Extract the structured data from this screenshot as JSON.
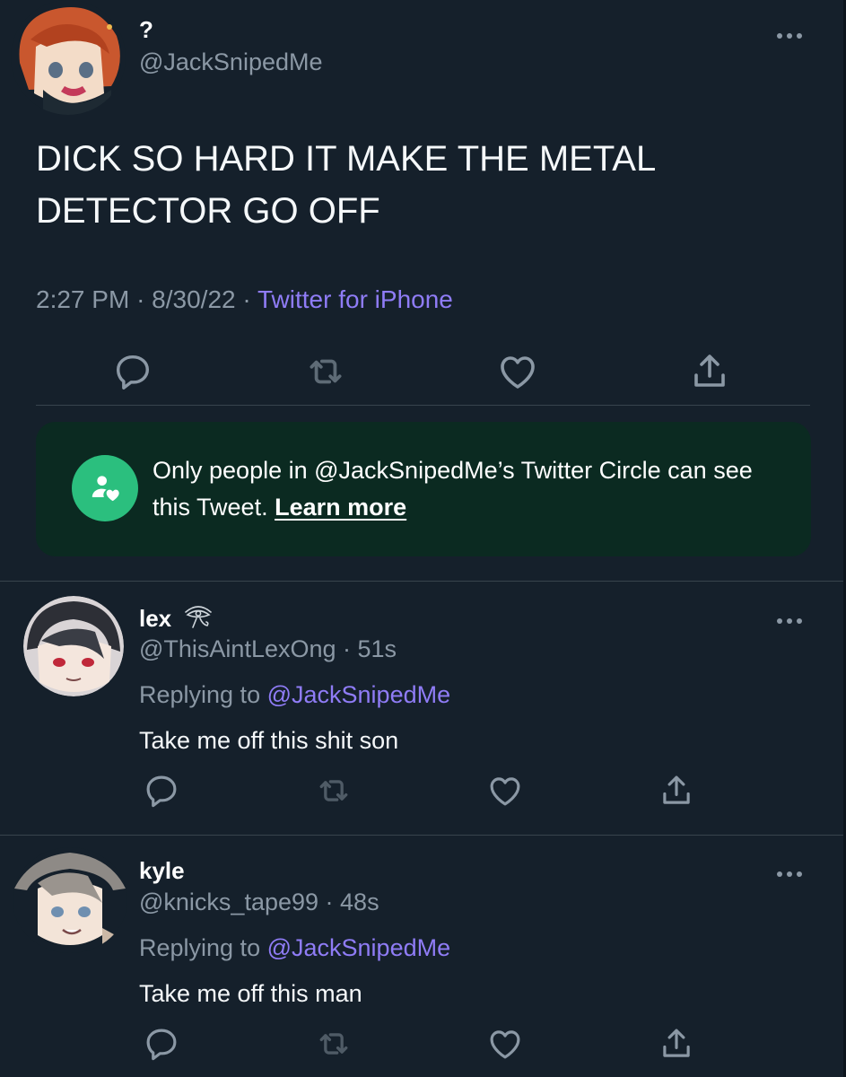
{
  "main_tweet": {
    "author_name": "?",
    "author_handle": "@JackSnipedMe",
    "text": "DICK SO HARD IT MAKE THE METAL DETECTOR GO OFF",
    "time": "2:27 PM",
    "date": "8/30/22",
    "separator": "·",
    "source": "Twitter for iPhone"
  },
  "circle_notice": {
    "text": "Only people in @JackSnipedMe’s Twitter Circle can see this Tweet.",
    "link": "Learn more"
  },
  "replies": [
    {
      "name": "lex",
      "handle": "@ThisAintLexOng",
      "age": "· 51s",
      "replying_label": "Replying to",
      "replying_handle": "@JackSnipedMe",
      "text": "Take me off this shit son"
    },
    {
      "name": "kyle",
      "handle": "@knicks_tape99",
      "age": "· 48s",
      "replying_label": "Replying to",
      "replying_handle": "@JackSnipedMe",
      "text": "Take me off this man"
    }
  ],
  "icons": [
    "reply-icon",
    "retweet-icon",
    "like-icon",
    "share-icon",
    "more-icon",
    "twitter-circle-icon",
    "eye-of-horus-emoji-icon"
  ],
  "colors": {
    "background": "#15202b",
    "link": "#8f7cf6",
    "muted": "#8b98a5",
    "circle_banner": "#0b2a21",
    "circle_icon": "#2bbf7e"
  }
}
